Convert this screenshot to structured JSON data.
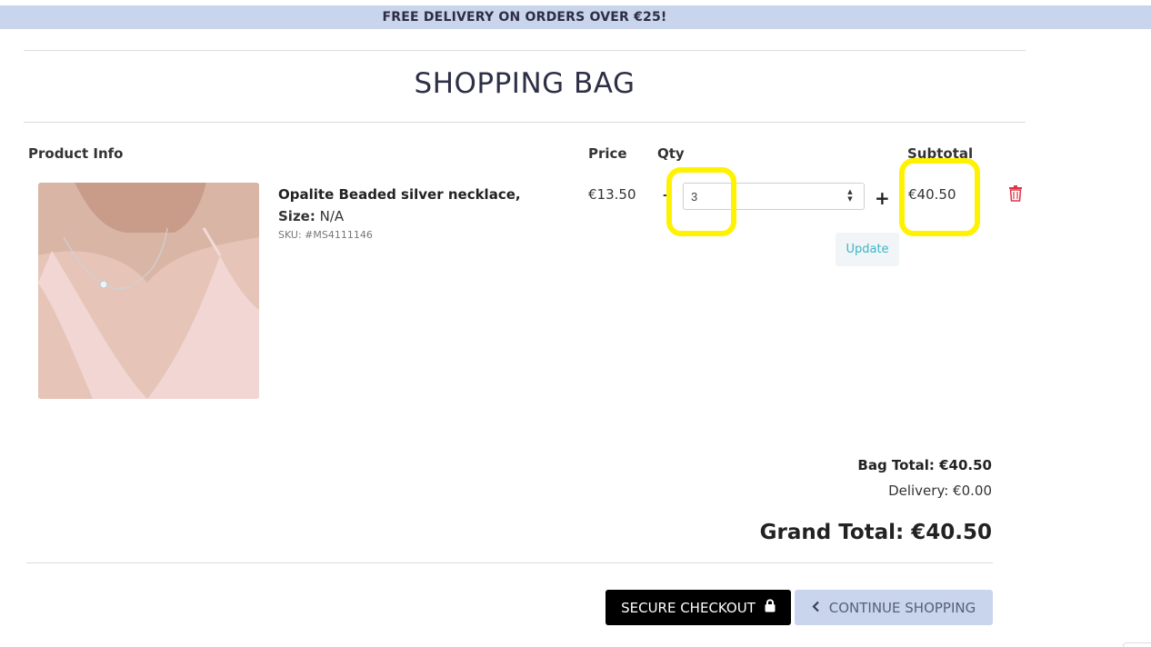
{
  "banner": {
    "text": "FREE DELIVERY ON ORDERS OVER €25!"
  },
  "page": {
    "title": "SHOPPING BAG"
  },
  "table": {
    "headers": {
      "product_info": "Product Info",
      "price": "Price",
      "qty": "Qty",
      "subtotal": "Subtotal"
    }
  },
  "item": {
    "name": "Opalite Beaded silver necklace,",
    "size_label": "Size:",
    "size_value": "N/A",
    "sku": "SKU: #MS4111146",
    "price": "€13.50",
    "minus": "-",
    "qty": "3",
    "plus": "+",
    "update_label": "Update",
    "subtotal": "€40.50",
    "image_alt": "Woman wearing opalite beaded silver necklace"
  },
  "totals": {
    "bag_total": "Bag Total: €40.50",
    "delivery": "Delivery: €0.00",
    "grand_total": "Grand Total: €40.50"
  },
  "actions": {
    "checkout_label": "SECURE CHECKOUT",
    "continue_label": "CONTINUE SHOPPING"
  },
  "colors": {
    "banner_bg": "#c8d5ec",
    "highlight": "#fff200",
    "trash": "#dc3545",
    "update_text": "#3cb5c4"
  },
  "icons": [
    "lock-icon",
    "chevron-left-icon",
    "trash-icon",
    "spinner-arrows-icon"
  ]
}
